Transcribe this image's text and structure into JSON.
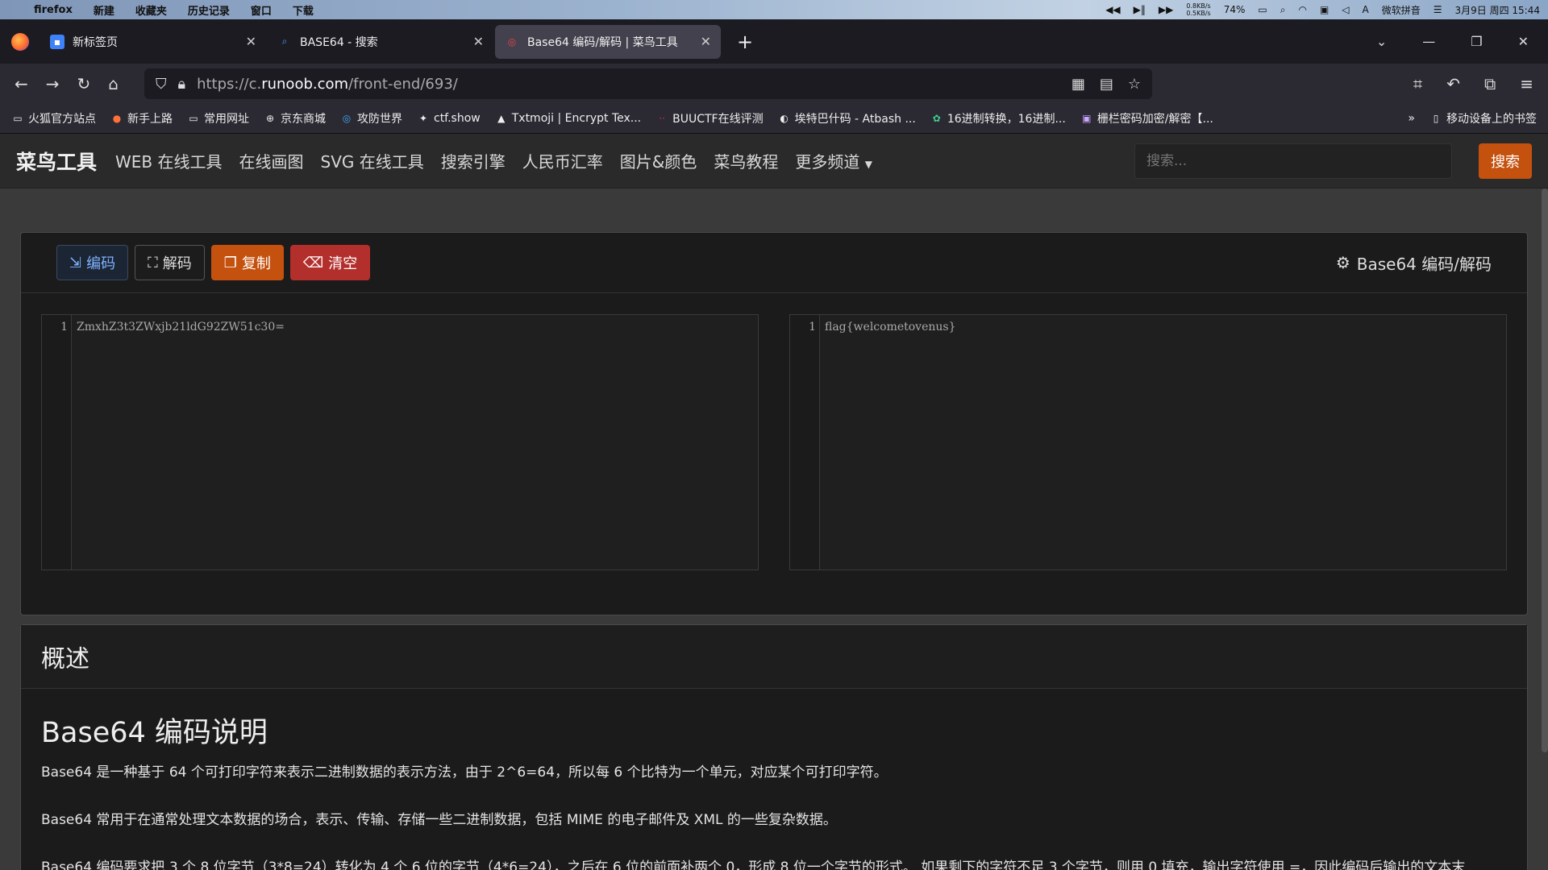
{
  "menubar": {
    "app": "firefox",
    "items": [
      "新建",
      "收藏夹",
      "历史记录",
      "窗口",
      "下载"
    ],
    "net_up": "0.8KB/s",
    "net_down": "0.5KB/s",
    "battery": "74%",
    "ime": "微软拼音",
    "datetime": "3月9日 周四 15:44"
  },
  "tabs": [
    {
      "title": "新标签页",
      "active": false
    },
    {
      "title": "BASE64 - 搜索",
      "active": false
    },
    {
      "title": "Base64 编码/解码 | 菜鸟工具",
      "active": true
    }
  ],
  "url": {
    "prefix": "https://c.",
    "domain": "runoob.com",
    "path": "/front-end/693/"
  },
  "bookmarks": [
    "火狐官方站点",
    "新手上路",
    "常用网址",
    "京东商城",
    "攻防世界",
    "ctf.show",
    "Txtmoji | Encrypt Tex...",
    "BUUCTF在线评测",
    "埃特巴什码 - Atbash ...",
    "16进制转换，16进制...",
    "栅栏密码加密/解密【..."
  ],
  "bookmarks_mobile": "移动设备上的书签",
  "site": {
    "brand": "菜鸟工具",
    "nav": [
      "WEB 在线工具",
      "在线画图",
      "SVG 在线工具",
      "搜索引擎",
      "人民币汇率",
      "图片&颜色",
      "菜鸟教程",
      "更多频道"
    ],
    "search_placeholder": "搜索...",
    "search_button": "搜索"
  },
  "tool": {
    "buttons": {
      "encode": "编码",
      "decode": "解码",
      "copy": "复制",
      "clear": "清空"
    },
    "title": "Base64 编码/解码",
    "input_line": "1",
    "input_text": "ZmxhZ3t3ZWxjb21ldG92ZW51c30=",
    "output_line": "1",
    "output_text": "flag{welcometovenus}"
  },
  "overview": {
    "heading": "概述",
    "title": "Base64 编码说明",
    "paragraphs": [
      "Base64 是一种基于 64 个可打印字符来表示二进制数据的表示方法，由于 2^6=64，所以每 6 个比特为一个单元，对应某个可打印字符。",
      "Base64 常用于在通常处理文本数据的场合，表示、传输、存储一些二进制数据，包括 MIME 的电子邮件及 XML 的一些复杂数据。",
      "Base64 编码要求把 3 个 8 位字节（3*8=24）转化为 4 个 6 位的字节（4*6=24），之后在 6 位的前面补两个 0，形成 8 位一个字节的形式。 如果剩下的字符不足 3 个字节，则用 0 填充，输出字符使用 =，因此编码后输出的文本末"
    ]
  }
}
